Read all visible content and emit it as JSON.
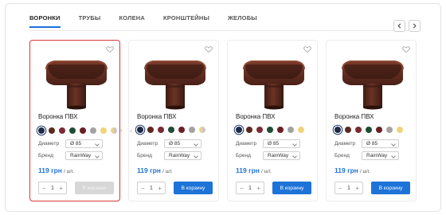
{
  "tabs": [
    {
      "label": "ВОРОНКИ",
      "active": true
    },
    {
      "label": "ТРУБЫ",
      "active": false
    },
    {
      "label": "КОЛЕНА",
      "active": false
    },
    {
      "label": "КРОНШТЕЙНЫ",
      "active": false
    },
    {
      "label": "ЖЕЛОБЫ",
      "active": false
    }
  ],
  "nav": {
    "prev_icon": "chevron-left-icon",
    "next_icon": "chevron-right-icon"
  },
  "colors": {
    "accent": "#1e73d8",
    "highlight": "#d9373a",
    "product_brown": "#5a2a1e"
  },
  "swatch_colors": [
    "#1d2a44",
    "#5a2a1e",
    "#7b2a33",
    "#1f4d34",
    "#6b1f24",
    "#a3a3a3",
    "#f0d37a",
    "#c7c7c7"
  ],
  "labels": {
    "diameter": "Диаметр",
    "brand": "Бренд",
    "unit": "/ шт.",
    "in_cart": "В корзине",
    "to_cart": "В корзину"
  },
  "products": [
    {
      "name": "Воронка ПВХ",
      "diameter": "Ø 85",
      "brand": "RainWay",
      "price": "119 грн",
      "qty": "1",
      "in_cart": true
    },
    {
      "name": "Воронка ПВХ",
      "diameter": "Ø 85",
      "brand": "RainWay",
      "price": "119 грн",
      "qty": "1",
      "in_cart": false
    },
    {
      "name": "Воронка ПВХ",
      "diameter": "Ø 85",
      "brand": "RainWay",
      "price": "119 грн",
      "qty": "1",
      "in_cart": false
    },
    {
      "name": "Воронка ПВХ",
      "diameter": "Ø 85",
      "brand": "RainWay",
      "price": "119 грн",
      "qty": "1",
      "in_cart": false
    }
  ]
}
